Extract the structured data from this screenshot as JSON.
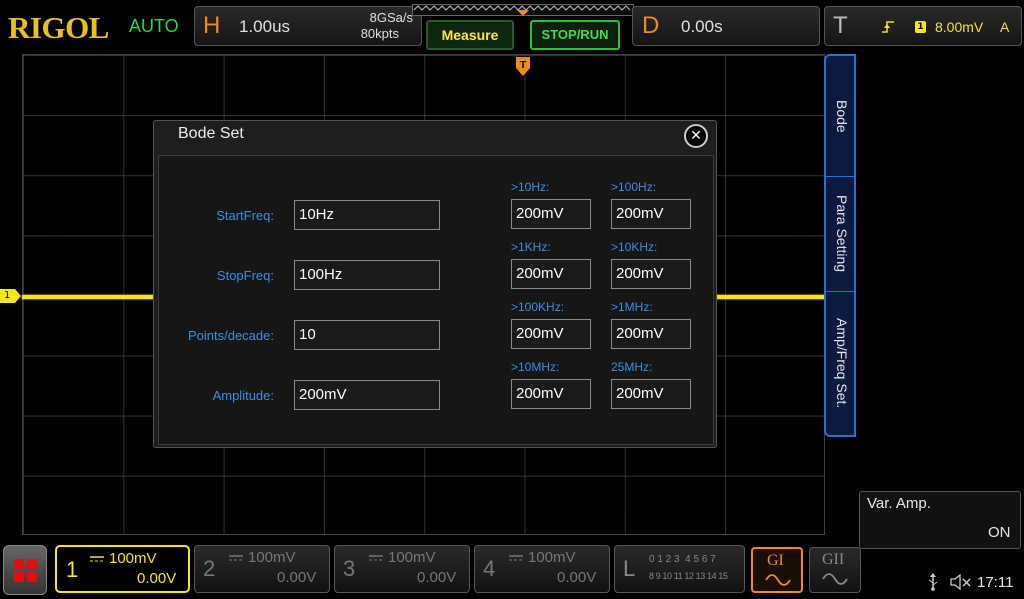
{
  "brand": "RIGOL",
  "trigger_mode": "AUTO",
  "horizontal": {
    "letter": "H",
    "timebase": "1.00us",
    "sample_rate": "8GSa/s",
    "memory_depth": "80kpts"
  },
  "toolbar": {
    "measure_label": "Measure",
    "stop_run_label": "STOP/RUN"
  },
  "delay": {
    "letter": "D",
    "value": "0.00s"
  },
  "trigger": {
    "letter": "T",
    "source": "1",
    "level": "8.00mV",
    "coupling": "A"
  },
  "right_menu": {
    "tabs": [
      "Bode",
      "Para Setting",
      "Amp/Freq Set."
    ]
  },
  "channel_marker": "1",
  "dialog": {
    "title": "Bode Set",
    "fields": [
      {
        "label": "StartFreq:",
        "value": "10Hz"
      },
      {
        "label": "StopFreq:",
        "value": "100Hz"
      },
      {
        "label": "Points/decade:",
        "value": "10"
      },
      {
        "label": "Amplitude:",
        "value": "200mV"
      }
    ],
    "var_amps": [
      {
        "label": ">10Hz:",
        "value": "200mV"
      },
      {
        "label": ">100Hz:",
        "value": "200mV"
      },
      {
        "label": ">1KHz:",
        "value": "200mV"
      },
      {
        "label": ">10KHz:",
        "value": "200mV"
      },
      {
        "label": ">100KHz:",
        "value": "200mV"
      },
      {
        "label": ">1MHz:",
        "value": "200mV"
      },
      {
        "label": ">10MHz:",
        "value": "200mV"
      },
      {
        "label": "25MHz:",
        "value": "200mV"
      }
    ]
  },
  "var_amp_box": {
    "label": "Var. Amp.",
    "state": "ON"
  },
  "channels": [
    {
      "num": "1",
      "scale": "100mV",
      "offset": "0.00V",
      "active": true,
      "color": "#f5e61a"
    },
    {
      "num": "2",
      "scale": "100mV",
      "offset": "0.00V",
      "active": false,
      "color": "#777777"
    },
    {
      "num": "3",
      "scale": "100mV",
      "offset": "0.00V",
      "active": false,
      "color": "#777777"
    },
    {
      "num": "4",
      "scale": "100mV",
      "offset": "0.00V",
      "active": false,
      "color": "#777777"
    }
  ],
  "logic": {
    "letter": "L",
    "row1": "0 1 2 3  4 5 6 7",
    "row2": "8 9 10 11 12 13 14 15"
  },
  "generators": {
    "g1": "GI",
    "g2": "GII"
  },
  "status": {
    "time": "17:11"
  },
  "colors": {
    "accent_orange": "#f08a1c",
    "channel1": "#f5e61a",
    "menu_blue": "#2d6fd1",
    "label_blue": "#3e8ee6",
    "green": "#27d84a"
  }
}
